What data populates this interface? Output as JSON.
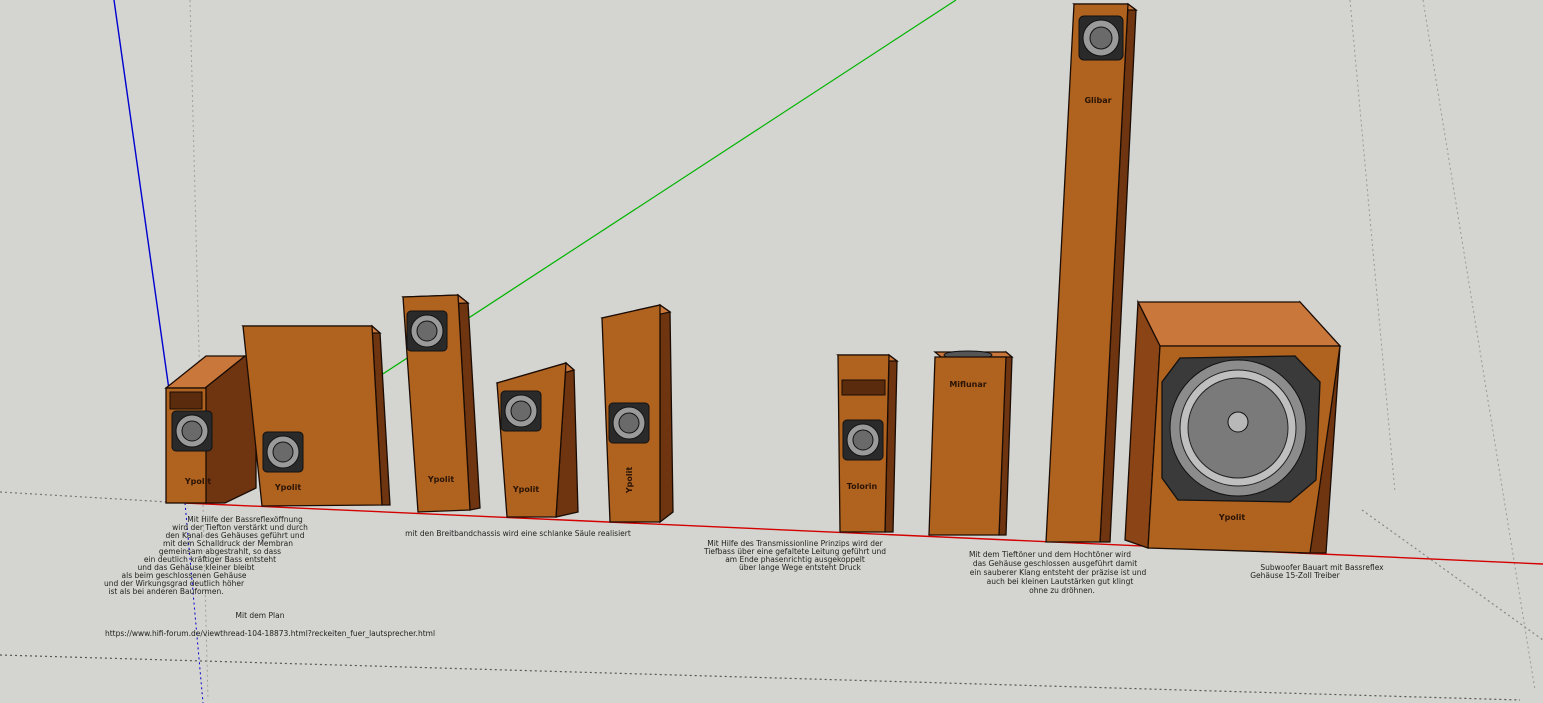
{
  "scene": {
    "background_color": "#d4d4d0",
    "cabinet_front_color": "#b0621f",
    "cabinet_side_color": "#6e3510",
    "cabinet_top_color": "#c9773a",
    "edge_color": "#1a0c04",
    "axis_colors": {
      "red": "#d40000",
      "green": "#00b400",
      "blue": "#0000d0"
    },
    "driver_color": "#7c7c7c"
  },
  "speakers": [
    {
      "wordmark": "Ypolit"
    },
    {
      "wordmark": "Ypolit"
    },
    {
      "wordmark": "Ypolit"
    },
    {
      "wordmark": "Ypolit"
    },
    {
      "wordmark": "Ypolit"
    },
    {
      "wordmark": "Tolorin"
    },
    {
      "wordmark": "Miflunar"
    },
    {
      "wordmark": "Glibar"
    },
    {
      "wordmark": "Ypolit"
    }
  ],
  "notes": {
    "block1": [
      "Mit Hilfe der Bassreflexöffnung",
      "wird der Tiefton verstärkt und durch",
      "den Kanal des Gehäuses geführt und",
      "mit dem Schalldruck der Membran",
      "gemeinsam abgestrahlt, so dass",
      "ein deutlich kräftiger Bass entsteht",
      "und das Gehäuse kleiner bleibt",
      "als beim geschlossenen Gehäuse",
      "und der Wirkungsgrad deutlich höher",
      "ist als bei anderen Bauformen."
    ],
    "block1_link_label": "Mit dem Plan",
    "block1_link": "https://www.hifi-forum.de/viewthread-104-18873.html?reckeiten_fuer_lautsprecher.html",
    "block2": [
      "mit den Breitbandchassis wird eine schlanke Säule realisiert"
    ],
    "block3": [
      "Mit Hilfe des Transmissionline Prinzips wird der",
      "Tiefbass über eine gefaltete Leitung geführt und",
      "am Ende phasenrichtig ausgekoppelt",
      "über lange Wege entsteht Druck"
    ],
    "block4": [
      "Mit dem Tieftöner und dem Hochtöner wird",
      "das Gehäuse geschlossen ausgeführt damit",
      "ein sauberer Klang entsteht der präzise ist und",
      "auch bei kleinen Lautstärken gut klingt",
      "ohne zu dröhnen."
    ],
    "block5": [
      "Subwoofer Bauart mit Bassreflex",
      "Gehäuse 15-Zoll Treiber"
    ]
  }
}
